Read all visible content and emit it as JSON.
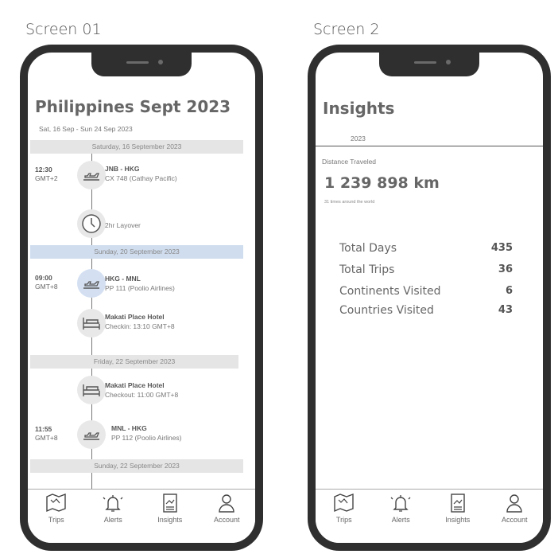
{
  "screens": [
    {
      "label": "Screen 01"
    },
    {
      "label": "Screen 2"
    }
  ],
  "trip": {
    "title": "Philippines Sept 2023",
    "date_range": "Sat, 16 Sep - Sun 24 Sep 2023",
    "days": [
      "Saturday, 16 September 2023",
      "Sunday, 20 September 2023",
      "Friday, 22 September 2023",
      "Sunday, 22 September 2023"
    ],
    "items": [
      {
        "time": "12:30",
        "tz": "GMT+2",
        "icon": "plane-icon",
        "head": "JNB - HKG",
        "sub": "CX 748 (Cathay Pacific)"
      },
      {
        "time": "",
        "tz": "",
        "icon": "clock-icon",
        "head": "",
        "sub": "2hr Layover"
      },
      {
        "time": "09:00",
        "tz": "GMT+8",
        "icon": "plane-icon",
        "head": "HKG - MNL",
        "sub": "PP 111 (Poolio Airlines)"
      },
      {
        "time": "",
        "tz": "",
        "icon": "bed-icon",
        "head": "Makati Place Hotel",
        "sub": "Checkin: 13:10 GMT+8"
      },
      {
        "time": "",
        "tz": "",
        "icon": "bed-icon",
        "head": "Makati Place Hotel",
        "sub": "Checkout: 11:00 GMT+8"
      },
      {
        "time": "11:55",
        "tz": "GMT+8",
        "icon": "plane-icon",
        "head": "MNL - HKG",
        "sub": "PP 112 (Poolio Airlines)"
      }
    ]
  },
  "insights": {
    "title": "Insights",
    "year_tab": "2023",
    "distance_label": "Distance Traveled",
    "distance_value": "1 239 898 km",
    "distance_note": "31 times around the world",
    "stats": [
      {
        "label": "Total Days",
        "value": "435"
      },
      {
        "label": "Total Trips",
        "value": "36"
      },
      {
        "label": "Continents Visited",
        "value": "6"
      },
      {
        "label": "Countries Visited",
        "value": "43"
      }
    ]
  },
  "nav": [
    {
      "label": "Trips",
      "icon": "map-icon"
    },
    {
      "label": "Alerts",
      "icon": "bell-icon"
    },
    {
      "label": "Insights",
      "icon": "chart-clipboard-icon"
    },
    {
      "label": "Account",
      "icon": "user-icon"
    }
  ]
}
